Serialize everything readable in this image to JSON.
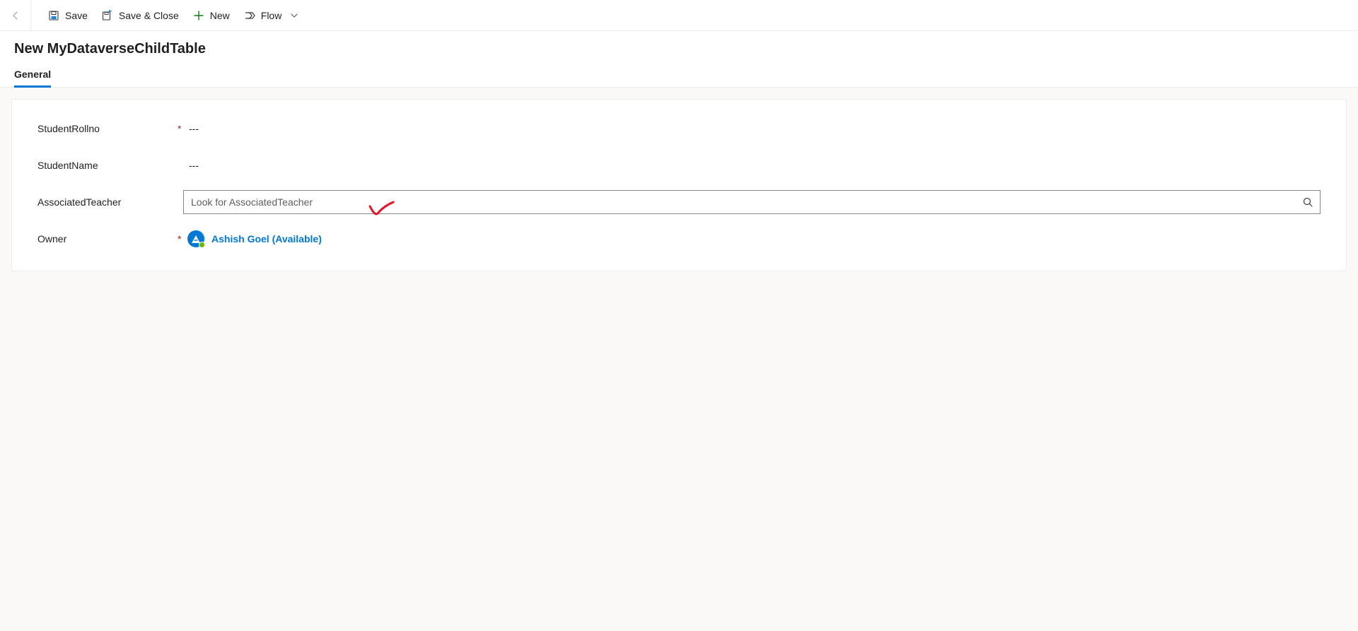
{
  "commandBar": {
    "save": "Save",
    "saveClose": "Save & Close",
    "new": "New",
    "flow": "Flow"
  },
  "header": {
    "title": "New MyDataverseChildTable"
  },
  "tabs": {
    "general": "General"
  },
  "fields": {
    "studentRollno": {
      "label": "StudentRollno",
      "value": "---"
    },
    "studentName": {
      "label": "StudentName",
      "value": "---"
    },
    "associatedTeacher": {
      "label": "AssociatedTeacher",
      "placeholder": "Look for AssociatedTeacher"
    },
    "owner": {
      "label": "Owner",
      "display": "Ashish Goel (Available)"
    }
  },
  "colors": {
    "accent": "#0078d4",
    "required": "#a4262c",
    "presence": "#6bb700",
    "newIcon": "#107c10"
  }
}
